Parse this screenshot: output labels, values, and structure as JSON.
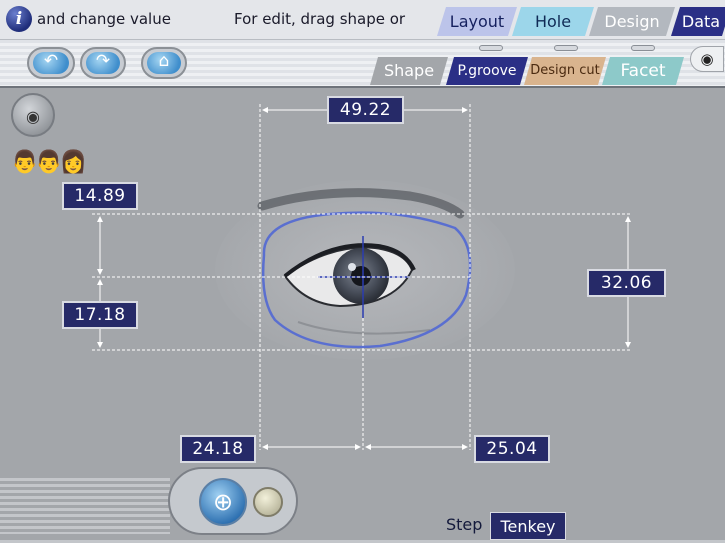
{
  "topbar": {
    "info_icon_glyph": "i",
    "info_left": "and change value",
    "info_right": "For edit, drag shape or",
    "tabs": [
      {
        "label": "Layout"
      },
      {
        "label": "Hole"
      },
      {
        "label": "Design"
      },
      {
        "label": "Data"
      }
    ]
  },
  "toolbar": {
    "undo_icon": "undo-arrow-icon",
    "redo_icon": "redo-arrow-icon",
    "home_icon": "home-icon",
    "undo_glyph": "↶",
    "redo_glyph": "↷",
    "home_glyph": "⌂",
    "camera_glyph": "◉",
    "sub_tabs": [
      {
        "label": "Shape"
      },
      {
        "label": "P.groove"
      },
      {
        "label": "Design cut"
      },
      {
        "label": "Facet"
      }
    ]
  },
  "tools": {
    "eye_glyph": "◉",
    "people_glyph": "👨👨👩"
  },
  "dimensions": {
    "width": "49.22",
    "upper_height": "14.89",
    "lower_height": "17.18",
    "total_height": "32.06",
    "left_width": "24.18",
    "right_width": "25.04"
  },
  "bottom": {
    "dial_glyph": "⊕",
    "step_label": "Step",
    "tenkey_label": "Tenkey"
  },
  "colors": {
    "background": "#a3a6aa",
    "value_box": "#262a68",
    "lens_outline": "#5a6fd0",
    "tab_layout": "#bcc4ea",
    "tab_hole": "#9cd6ea",
    "tab_data": "#2b2f86"
  }
}
